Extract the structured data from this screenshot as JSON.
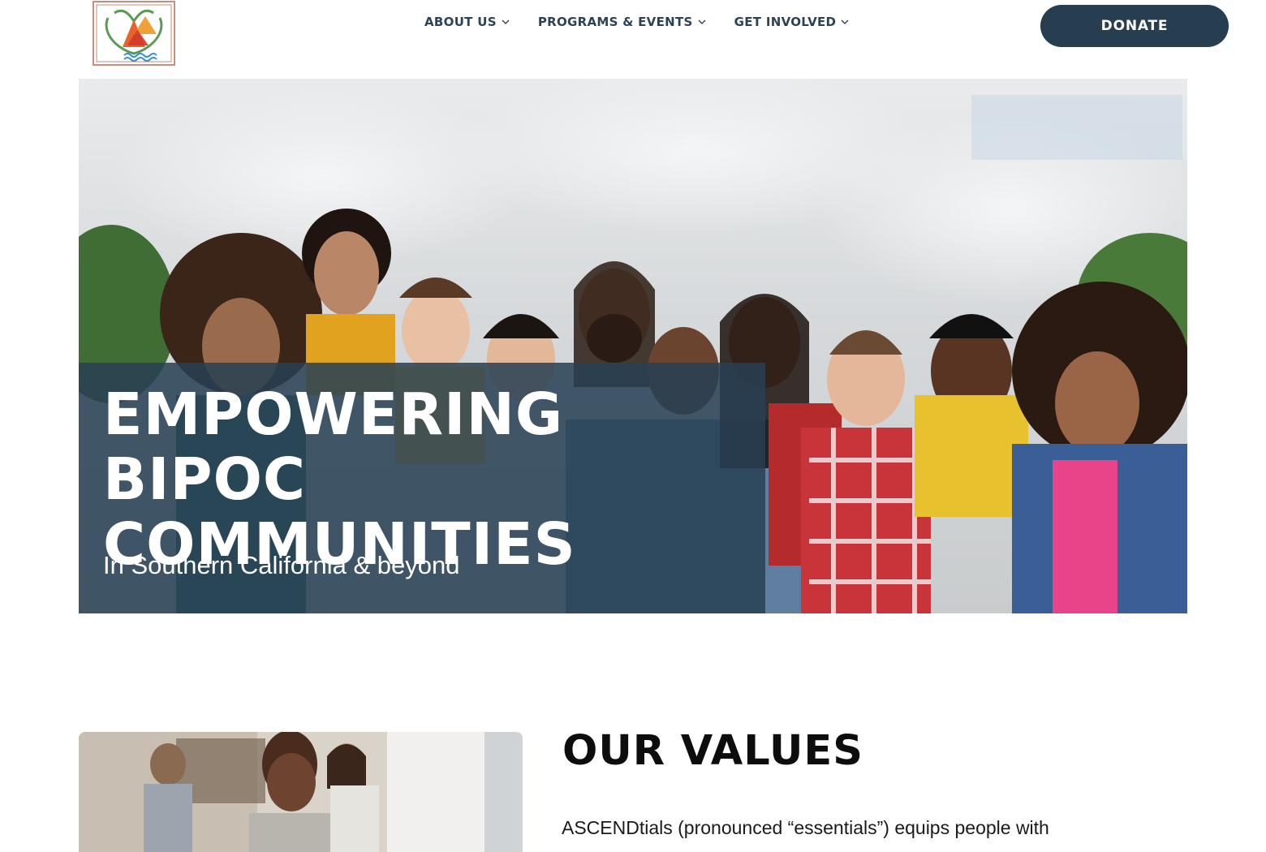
{
  "header": {
    "logo_alt": "ASCENDtials logo",
    "nav": [
      {
        "label": "ABOUT US"
      },
      {
        "label": "PROGRAMS & EVENTS"
      },
      {
        "label": "GET INVOLVED"
      }
    ],
    "donate_label": "DONATE"
  },
  "hero": {
    "title_line1": "EMPOWERING BIPOC",
    "title_line2": "COMMUNITIES",
    "subtitle": "In Southern California & beyond"
  },
  "values": {
    "title": "OUR VALUES",
    "text": "ASCENDtials (pronounced “essentials”) equips people with"
  },
  "colors": {
    "brand_dark": "#263e50",
    "nav_text": "#2c4356",
    "hero_overlay": "#284054"
  },
  "icons": {
    "nav_chevron": "chevron-down-icon"
  }
}
